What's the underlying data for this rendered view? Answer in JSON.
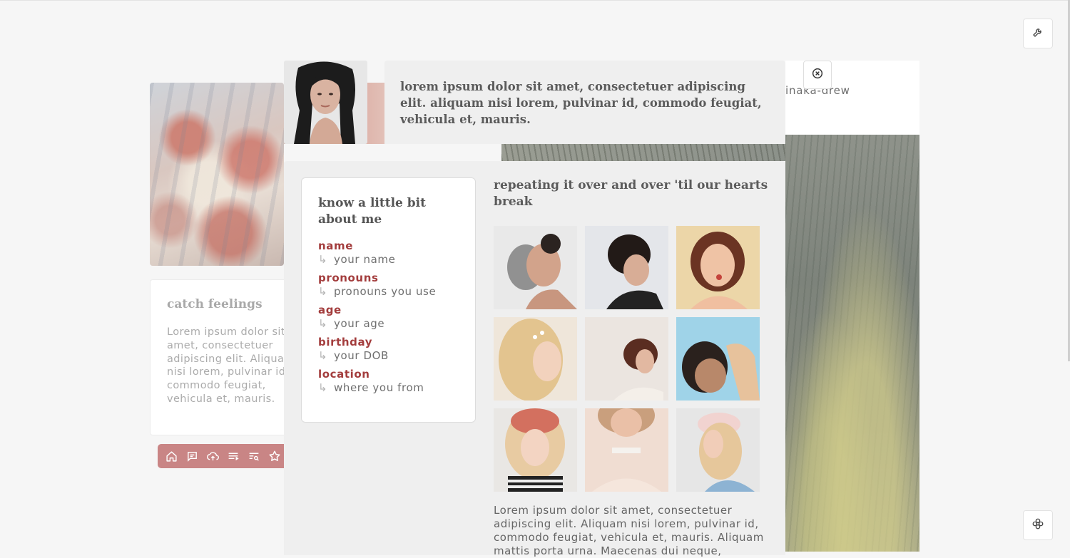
{
  "toolbar": {
    "settings_icon": "wrench-icon",
    "theme_icon": "flower-icon"
  },
  "close_icon": "close-circle-icon",
  "quote": "lorem ipsum dolor sit amet, consectetuer adipiscing elit. aliquam nisi lorem, pulvinar id, commodo feugiat, vehicula et, mauris.",
  "username": "inaka-drew",
  "left_card": {
    "title": "catch feelings",
    "text": "Lorem ipsum dolor sit amet, consectetuer adipiscing elit. Aliquam nisi lorem, pulvinar id, commodo feugiat, vehicula et, mauris."
  },
  "nav_icons": [
    "home-icon",
    "message-icon",
    "cloud-upload-icon",
    "playlist-icon",
    "search-list-icon",
    "star-icon"
  ],
  "about": {
    "title": "know a little bit about me",
    "rows": [
      {
        "label": "name",
        "value": "your name"
      },
      {
        "label": "pronouns",
        "value": "pronouns you use"
      },
      {
        "label": "age",
        "value": "your age"
      },
      {
        "label": "birthday",
        "value": "your DOB"
      },
      {
        "label": "location",
        "value": "where you from"
      }
    ],
    "arrow": "↳"
  },
  "gallery": {
    "title": "repeating it over and over 'til our hearts break",
    "paragraph": "Lorem ipsum dolor sit amet, consectetuer adipiscing elit. Aliquam nisi lorem, pulvinar id, commodo feugiat, vehicula et, mauris. Aliquam mattis porta urna. Maecenas dui neque,"
  },
  "colors": {
    "accent": "#a33d3d",
    "navbar": "#c98585",
    "panel": "#efefef"
  }
}
